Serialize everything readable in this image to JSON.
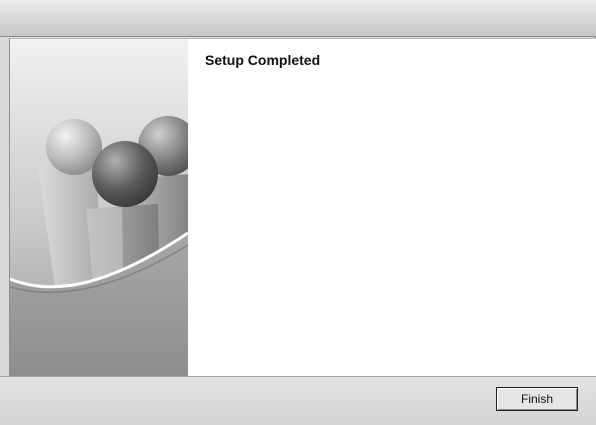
{
  "wizard": {
    "heading": "Setup Completed",
    "finish_label": "Finish",
    "side_image": "people-spheres-artwork"
  }
}
